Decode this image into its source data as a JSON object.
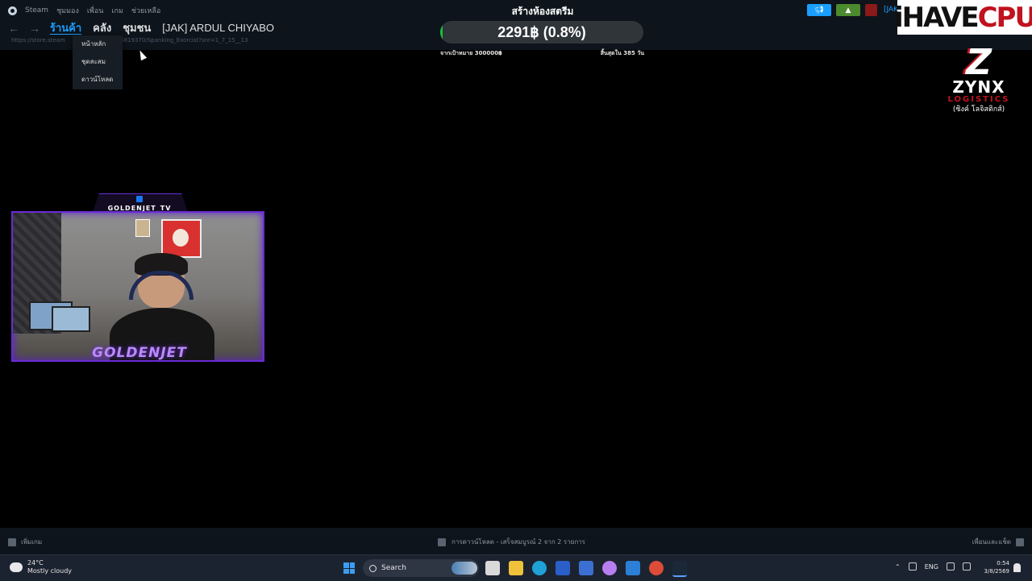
{
  "steam_menu": [
    "Steam",
    "ชุมมอง",
    "เพื่อน",
    "เกม",
    "ช่วยเหลือ"
  ],
  "nav": {
    "back": "←",
    "forward": "→",
    "tabs": [
      {
        "label": "ร้านค้า",
        "active": true
      },
      {
        "label": "คลัง",
        "active": false
      },
      {
        "label": "ชุมชน",
        "active": false
      }
    ],
    "username": "[JAK] ARDUL CHIYABO"
  },
  "url_bar": {
    "left": "https://store.steam",
    "right": "/4819370/Spanking_Exorcist?snr=1_7_15__13"
  },
  "store_dropdown": [
    "หน้าหลัก",
    "ชุดสะสม",
    "ดาวน์โหลด"
  ],
  "donation_goal": {
    "title": "สร้างห้องสตรีม",
    "progress_text": "2291฿ (0.8%)",
    "progress_fraction": 0.008,
    "target_text": "จากเป้าหมาย 300000฿",
    "ends_text": "สิ้นสุดใน 385 วัน",
    "fill_color": "#18c13a"
  },
  "top_right": {
    "announce_icon": "megaphone-icon",
    "notification_icon": "bell-icon",
    "user_short": "[JAK"
  },
  "overlay_brand": {
    "part1": "iHAVE",
    "part2": "CPU"
  },
  "sponsor": {
    "mark": "Z",
    "name": "ZYNX",
    "tagline": "LOGISTICS",
    "thai_name": "(ซิงค์ โลจิสติกส์)"
  },
  "webcam": {
    "channel": "GOLDENJET_TV",
    "logo_text": "GOLDENJET"
  },
  "steam_bottom": {
    "add_game": "เพิ่มเกม",
    "downloads": "การดาวน์โหลด - เสร็จสมบูรณ์ 2 จาก 2 รายการ",
    "friends_chat": "เพื่อนและแช็ต"
  },
  "taskbar": {
    "temperature": "24°C",
    "condition": "Mostly cloudy",
    "search_placeholder": "Search",
    "language": "ENG",
    "time": "0:54",
    "date": "3/8/2569"
  }
}
